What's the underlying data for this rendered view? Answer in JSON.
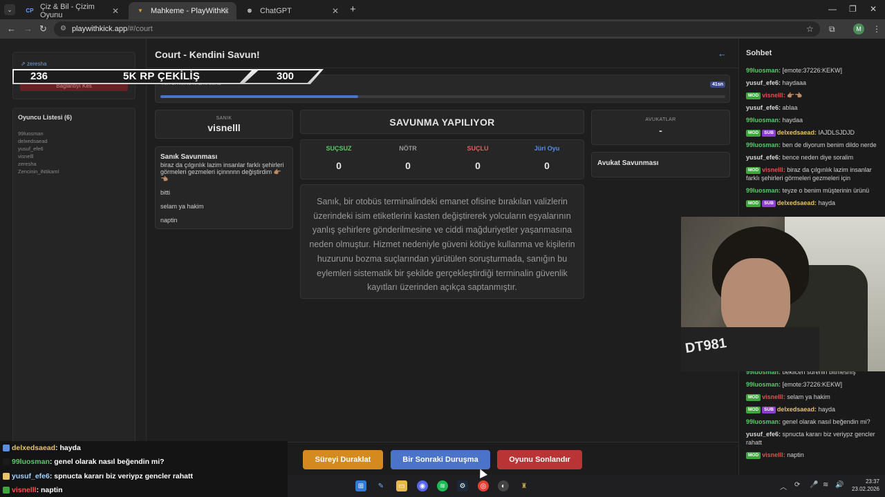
{
  "browser": {
    "tabs": [
      {
        "label": "Çiz & Bil - Çizim Oyunu",
        "favicon": "CP"
      },
      {
        "label": "Mahkeme - PlayWithKick | Play",
        "favicon": "▼"
      },
      {
        "label": "ChatGPT",
        "favicon": "⊛"
      }
    ],
    "url_host": "playwithkick.app",
    "url_path": "/#/court",
    "profile_initial": "M"
  },
  "overlay_banner": {
    "left_number": "236",
    "text": "5K RP ÇEKİLİŞ",
    "right_number": "300"
  },
  "sidebar": {
    "username": "zeresha",
    "button_peek": "Bağlantıyı Kes",
    "players_title": "Oyuncu Listesi (6)",
    "players": [
      "99luosman",
      "delxedsaead",
      "yusuf_efe6",
      "visnelll",
      "zeresha",
      "Zencinin_iNtikaml"
    ]
  },
  "page": {
    "title": "Court - Kendini Savun!"
  },
  "timer": {
    "label": "YÜR BİTİMİNE KALAN SÜRE",
    "seconds_text": "41sn",
    "progress": 0.35
  },
  "defendant": {
    "label": "SANIK",
    "name": "visnelll"
  },
  "defense": {
    "title": "Sanık Savunması",
    "messages": [
      "biraz da çılgınlık lazim insanlar farklı şehirleri görmeleri gezmeleri içinnnnn değiştirdim 👉🏽👈🏽",
      "bitti",
      "selam ya hakim",
      "naptin"
    ]
  },
  "status": {
    "text": "SAVUNMA YAPILIYOR"
  },
  "votes": [
    {
      "label": "SUÇSUZ",
      "value": "0",
      "color": "#5cc76a"
    },
    {
      "label": "NÖTR",
      "value": "0",
      "color": "#9a9a9a"
    },
    {
      "label": "SUÇLU",
      "value": "0",
      "color": "#e06060"
    },
    {
      "label": "Jüri Oyu",
      "value": "0",
      "color": "#5b8de0"
    }
  ],
  "case_text": "Sanık, bir otobüs terminalindeki emanet ofisine bırakılan valizlerin üzerindeki isim etiketlerini kasten değiştirerek yolcuların eşyalarının yanlış şehirlere gönderilmesine ve ciddi mağduriyetler yaşanmasına neden olmuştur. Hizmet nedeniyle güveni kötüye kullanma ve kişilerin huzurunu bozma suçlarından yürütülen soruşturmada, sanığın bu eylemleri sistematik bir şekilde gerçekleştirdiği terminalin güvenlik kayıtları üzerinden açıkça saptanmıştır.",
  "lawyers": {
    "label": "AVUKATLAR",
    "value": "-",
    "defense_title": "Avukat Savunması"
  },
  "actions": {
    "pause": "Süreyi Duraklat",
    "next": "Bir Sonraki Duruşma",
    "end": "Oyunu Sonlandır"
  },
  "chat": {
    "title": "Sohbet",
    "messages_top": [
      {
        "user": "99luosman",
        "color": "#5cc76a",
        "text": "[emote:37226:KEKW]",
        "badges": []
      },
      {
        "user": "yusuf_efe6",
        "color": "#d8d8d8",
        "text": "haydaaa",
        "badges": []
      },
      {
        "user": "visnelll",
        "color": "#e05050",
        "text": "👉🏽👈🏽",
        "badges": [
          "MOD"
        ]
      },
      {
        "user": "yusuf_efe6",
        "color": "#d8d8d8",
        "text": "ablaa",
        "badges": []
      },
      {
        "user": "99luosman",
        "color": "#5cc76a",
        "text": "haydaa",
        "badges": []
      },
      {
        "user": "delxedsaead",
        "color": "#e8c36a",
        "text": "IAJDLSJDJD",
        "badges": [
          "MOD",
          "SUB"
        ]
      },
      {
        "user": "99luosman",
        "color": "#5cc76a",
        "text": "ben de diyorum benim dildo nerde",
        "badges": []
      },
      {
        "user": "yusuf_efe6",
        "color": "#d8d8d8",
        "text": "bence neden diye soralim",
        "badges": []
      },
      {
        "user": "visnelll",
        "color": "#e05050",
        "text": "biraz da çılgınlık lazim insanlar farklı şehirleri görmeleri gezmeleri için",
        "badges": [
          "MOD"
        ]
      },
      {
        "user": "99luosman",
        "color": "#5cc76a",
        "text": "teyze o benim müşterinin ürünü",
        "badges": []
      },
      {
        "user": "delxedsaead",
        "color": "#e8c36a",
        "text": "hayda",
        "badges": [
          "MOD",
          "SUB"
        ]
      }
    ],
    "messages_bottom": [
      {
        "user": "99luosman",
        "color": "#5cc76a",
        "text": "bekilcen sürenin bitmesnış",
        "badges": []
      },
      {
        "user": "99luosman",
        "color": "#5cc76a",
        "text": "[emote:37226:KEKW]",
        "badges": []
      },
      {
        "user": "visnelll",
        "color": "#e05050",
        "text": "selam ya hakim",
        "badges": [
          "MOD"
        ]
      },
      {
        "user": "delxedsaead",
        "color": "#e8c36a",
        "text": "hayda",
        "badges": [
          "MOD",
          "SUB"
        ]
      },
      {
        "user": "99luosman",
        "color": "#5cc76a",
        "text": "genel olarak nasıl beğendin mi?",
        "badges": []
      },
      {
        "user": "yusuf_efe6",
        "color": "#d8d8d8",
        "text": "spnucta kararı biz veriypz gencler rahatt",
        "badges": []
      },
      {
        "user": "visnelll",
        "color": "#e05050",
        "text": "naptin",
        "badges": [
          "MOD"
        ]
      }
    ]
  },
  "webcam_shirt_text": "DT981",
  "stream_chat_overlay": [
    {
      "user": "delxedsaead",
      "color": "#e8c36a",
      "text": ": hayda"
    },
    {
      "user": "99luosman",
      "color": "#5cc76a",
      "text": ": genel olarak nasıl beğendin mi?"
    },
    {
      "user": "yusuf_efe6",
      "color": "#9fd0ff",
      "text": ": spnucta kararı biz veriypz gencler rahatt"
    },
    {
      "user": "visnelll",
      "color": "#ff5050",
      "text": ": naptin"
    }
  ],
  "taskbar": {
    "time": "23:37",
    "date": "23.02.2026"
  }
}
